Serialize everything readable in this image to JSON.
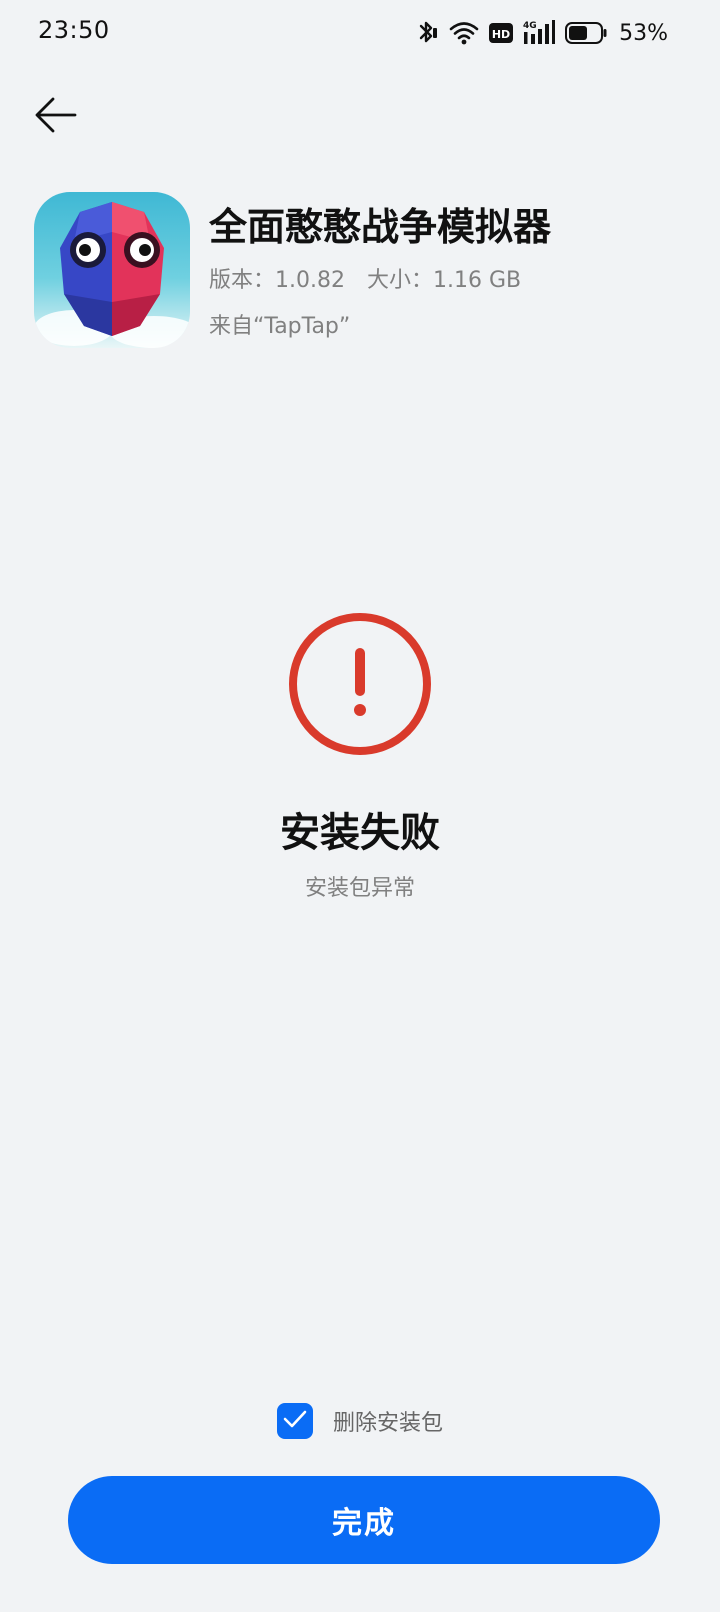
{
  "status_bar": {
    "time": "23:50",
    "battery_percent": "53%",
    "network_badge": "4G",
    "hd_badge": "HD",
    "icons": [
      "bluetooth-icon",
      "wifi-icon",
      "hd-icon",
      "cellular-signal-icon",
      "battery-icon"
    ]
  },
  "nav": {
    "back_icon": "arrow-left-icon"
  },
  "app": {
    "name": "全面憨憨战争模拟器",
    "version_label": "版本：1.0.82",
    "size_label": "大小：1.16 GB",
    "source_label": "来自“TapTap”"
  },
  "result": {
    "icon": "error-exclamation-icon",
    "title": "安装失败",
    "subtitle": "安装包异常",
    "accent_color": "#d93a2b"
  },
  "options": {
    "delete_package_label": "删除安装包",
    "delete_package_checked": true
  },
  "actions": {
    "done_label": "完成",
    "primary_color": "#0a6cf5"
  }
}
